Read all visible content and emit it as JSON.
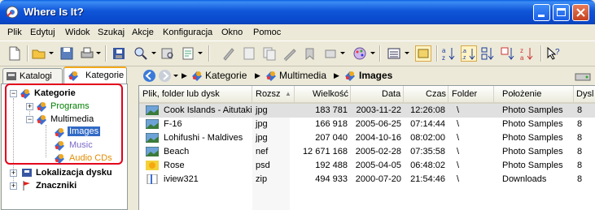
{
  "window": {
    "title": "Where Is It?"
  },
  "menu": [
    "Plik",
    "Edytuj",
    "Widok",
    "Szukaj",
    "Akcje",
    "Konfiguracja",
    "Okno",
    "Pomoc"
  ],
  "tabs": {
    "catalogs": "Katalogi",
    "categories": "Kategorie"
  },
  "tree": {
    "root": "Kategorie",
    "programs": "Programs",
    "multimedia": "Multimedia",
    "images": "Images",
    "music": "Music",
    "audio_cds": "Audio CDs",
    "disk_location": "Lokalizacja dysku",
    "bookmarks": "Znaczniki"
  },
  "breadcrumb": [
    "Kategorie",
    "Multimedia",
    "Images"
  ],
  "columns": {
    "name": "Plik, folder lub dysk",
    "ext": "Rozsz",
    "size": "Wielkość",
    "date": "Data",
    "time": "Czas",
    "folder": "Folder",
    "location": "Położenie",
    "disk": "Dysl"
  },
  "rows": [
    {
      "name": "Cook Islands - Aitutaki",
      "ext": "jpg",
      "size": "183 781",
      "date": "2003-11-22",
      "time": "12:26:08",
      "folder": "\\",
      "location": "Photo Samples",
      "disk": "8",
      "icon": "photo-icon"
    },
    {
      "name": "F-16",
      "ext": "jpg",
      "size": "166 918",
      "date": "2005-06-25",
      "time": "07:14:44",
      "folder": "\\",
      "location": "Photo Samples",
      "disk": "8",
      "icon": "photo-icon"
    },
    {
      "name": "Lohifushi - Maldives",
      "ext": "jpg",
      "size": "207 040",
      "date": "2004-10-16",
      "time": "08:02:00",
      "folder": "\\",
      "location": "Photo Samples",
      "disk": "8",
      "icon": "photo-icon"
    },
    {
      "name": "Beach",
      "ext": "nef",
      "size": "12 671 168",
      "date": "2005-02-28",
      "time": "07:35:58",
      "folder": "\\",
      "location": "Photo Samples",
      "disk": "8",
      "icon": "photo-icon"
    },
    {
      "name": "Rose",
      "ext": "psd",
      "size": "192 488",
      "date": "2005-04-05",
      "time": "06:48:02",
      "folder": "\\",
      "location": "Photo Samples",
      "disk": "8",
      "icon": "flower-icon"
    },
    {
      "name": "iview321",
      "ext": "zip",
      "size": "494 933",
      "date": "2000-07-20",
      "time": "21:54:46",
      "folder": "\\",
      "location": "Downloads",
      "disk": "8",
      "icon": "zip-icon"
    }
  ],
  "colors": {
    "titlebar": "#0a4bcf",
    "highlight": "#316ac5",
    "programs": "#008000",
    "music": "#7b68c8",
    "audio_cds": "#e08c00",
    "annotation": "#e3001b"
  }
}
